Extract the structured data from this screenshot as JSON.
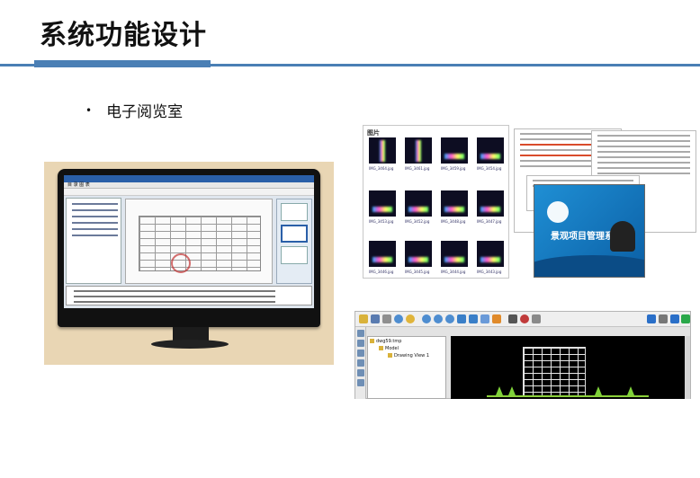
{
  "slide": {
    "title": "系统功能设计",
    "bullet": "电子阅览室"
  },
  "colors": {
    "accent": "#4a7fb5",
    "monitor_background": "#e9d6b4",
    "splash_blue": "#1f8fd4"
  },
  "monitor_screenshot": {
    "menu_text": "目 录 图 表"
  },
  "gallery": {
    "label": "图片",
    "captions": [
      "IMG_3464.jpg",
      "IMG_3461.jpg",
      "IMG_3459.jpg",
      "IMG_3454.jpg",
      "IMG_3453.jpg",
      "IMG_3452.jpg",
      "IMG_3448.jpg",
      "IMG_3447.jpg",
      "IMG_3446.jpg",
      "IMG_3445.jpg",
      "IMG_3444.jpg",
      "IMG_3443.jpg"
    ]
  },
  "documents": {
    "splash_title": "景观项目管理系统"
  },
  "cad_viewer": {
    "tree_root": "dwg59.tmp",
    "tree_model": "Model",
    "tree_view": "Drawing View 1"
  }
}
